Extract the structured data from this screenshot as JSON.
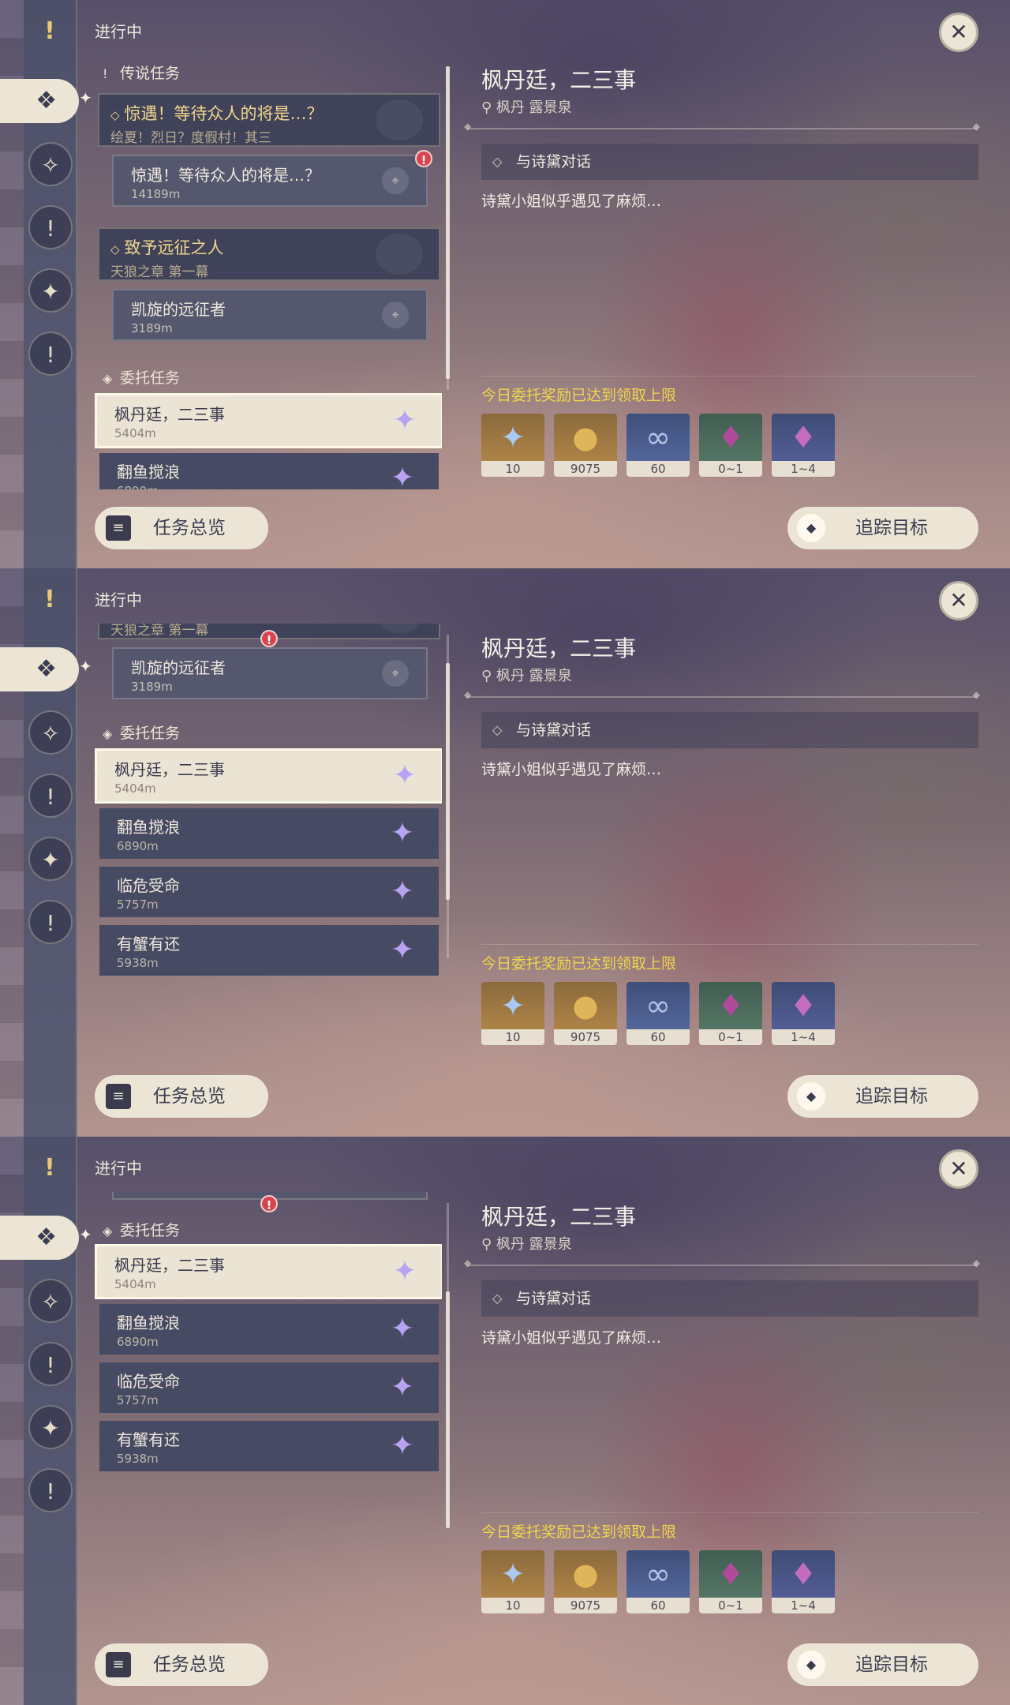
{
  "sidebar": {
    "status_heading": "进行中",
    "tabs": [
      {
        "name": "all-quests",
        "glyph": "❖"
      },
      {
        "name": "archon",
        "glyph": "✧"
      },
      {
        "name": "story",
        "glyph": "!"
      },
      {
        "name": "world",
        "glyph": "✦"
      },
      {
        "name": "event",
        "glyph": "!"
      }
    ]
  },
  "sections": {
    "legend": "传说任务",
    "commission": "委托任务"
  },
  "legend_quests": [
    {
      "title": "惊遇！等待众人的将是…？",
      "subtitle": "绘夏！烈日？度假村！其三",
      "step": {
        "title": "惊遇！等待众人的将是…？",
        "distance": "14189m"
      }
    },
    {
      "title": "致予远征之人",
      "subtitle": "天狼之章 第一幕",
      "step": {
        "title": "凯旋的远征者",
        "distance": "3189m"
      }
    }
  ],
  "commissions": [
    {
      "title": "枫丹廷，二三事",
      "distance": "5404m"
    },
    {
      "title": "翻鱼搅浪",
      "distance": "6890m"
    },
    {
      "title": "临危受命",
      "distance": "5757m"
    },
    {
      "title": "有蟹有还",
      "distance": "5938m"
    }
  ],
  "detail": {
    "title": "枫丹廷，二三事",
    "location": "枫丹 露景泉",
    "objective": "与诗黛对话",
    "description": "诗黛小姐似乎遇见了麻烦…",
    "reward_notice": "今日委托奖励已达到领取上限",
    "rewards": [
      {
        "icon": "primogem-icon",
        "count": "10"
      },
      {
        "icon": "mora-icon",
        "count": "9075"
      },
      {
        "icon": "companionship-exp-icon",
        "count": "60"
      },
      {
        "icon": "crystal-chunk-icon",
        "count": "0~1"
      },
      {
        "icon": "purple-crystal-icon",
        "count": "1~4"
      }
    ]
  },
  "buttons": {
    "overview": "任务总览",
    "track": "追踪目标",
    "close": "✕"
  },
  "colors": {
    "reward_notice": "#f0d64a",
    "legend_title": "#f0d58e",
    "commission_star": "#b8a2f2"
  }
}
